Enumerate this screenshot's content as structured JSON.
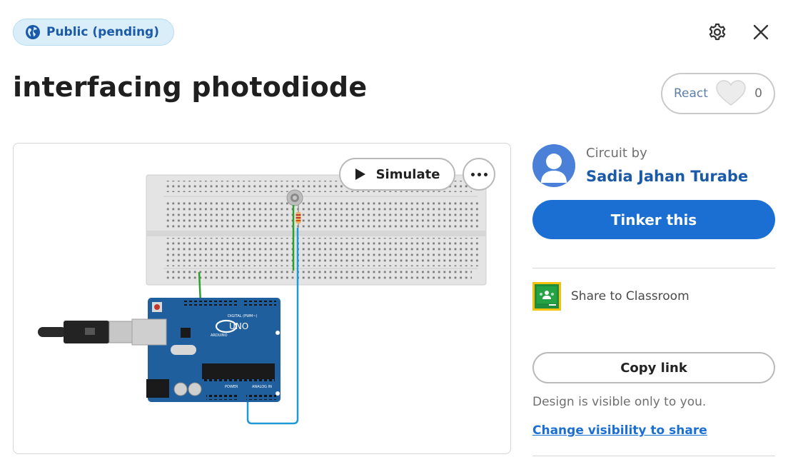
{
  "header": {
    "visibility_badge": "Public (pending)",
    "settings_icon": "gear-icon",
    "close_icon": "close-icon"
  },
  "design": {
    "title": "interfacing photodiode"
  },
  "react": {
    "label": "React",
    "count": "0",
    "icon": "heart-icon"
  },
  "preview": {
    "simulate_label": "Simulate",
    "simulate_icon": "play-icon",
    "more_icon": "more-options-icon"
  },
  "author": {
    "prefix": "Circuit by",
    "name": "Sadia Jahan Turabe"
  },
  "actions": {
    "tinker_label": "Tinker this",
    "share_classroom_label": "Share to Classroom",
    "copy_link_label": "Copy link",
    "visibility_note": "Design is visible only to you.",
    "change_visibility_label": "Change visibility to share"
  },
  "colors": {
    "accent": "#1b6fd3",
    "badge_bg": "#d9eef9",
    "arduino_blue": "#1f5f9d"
  }
}
